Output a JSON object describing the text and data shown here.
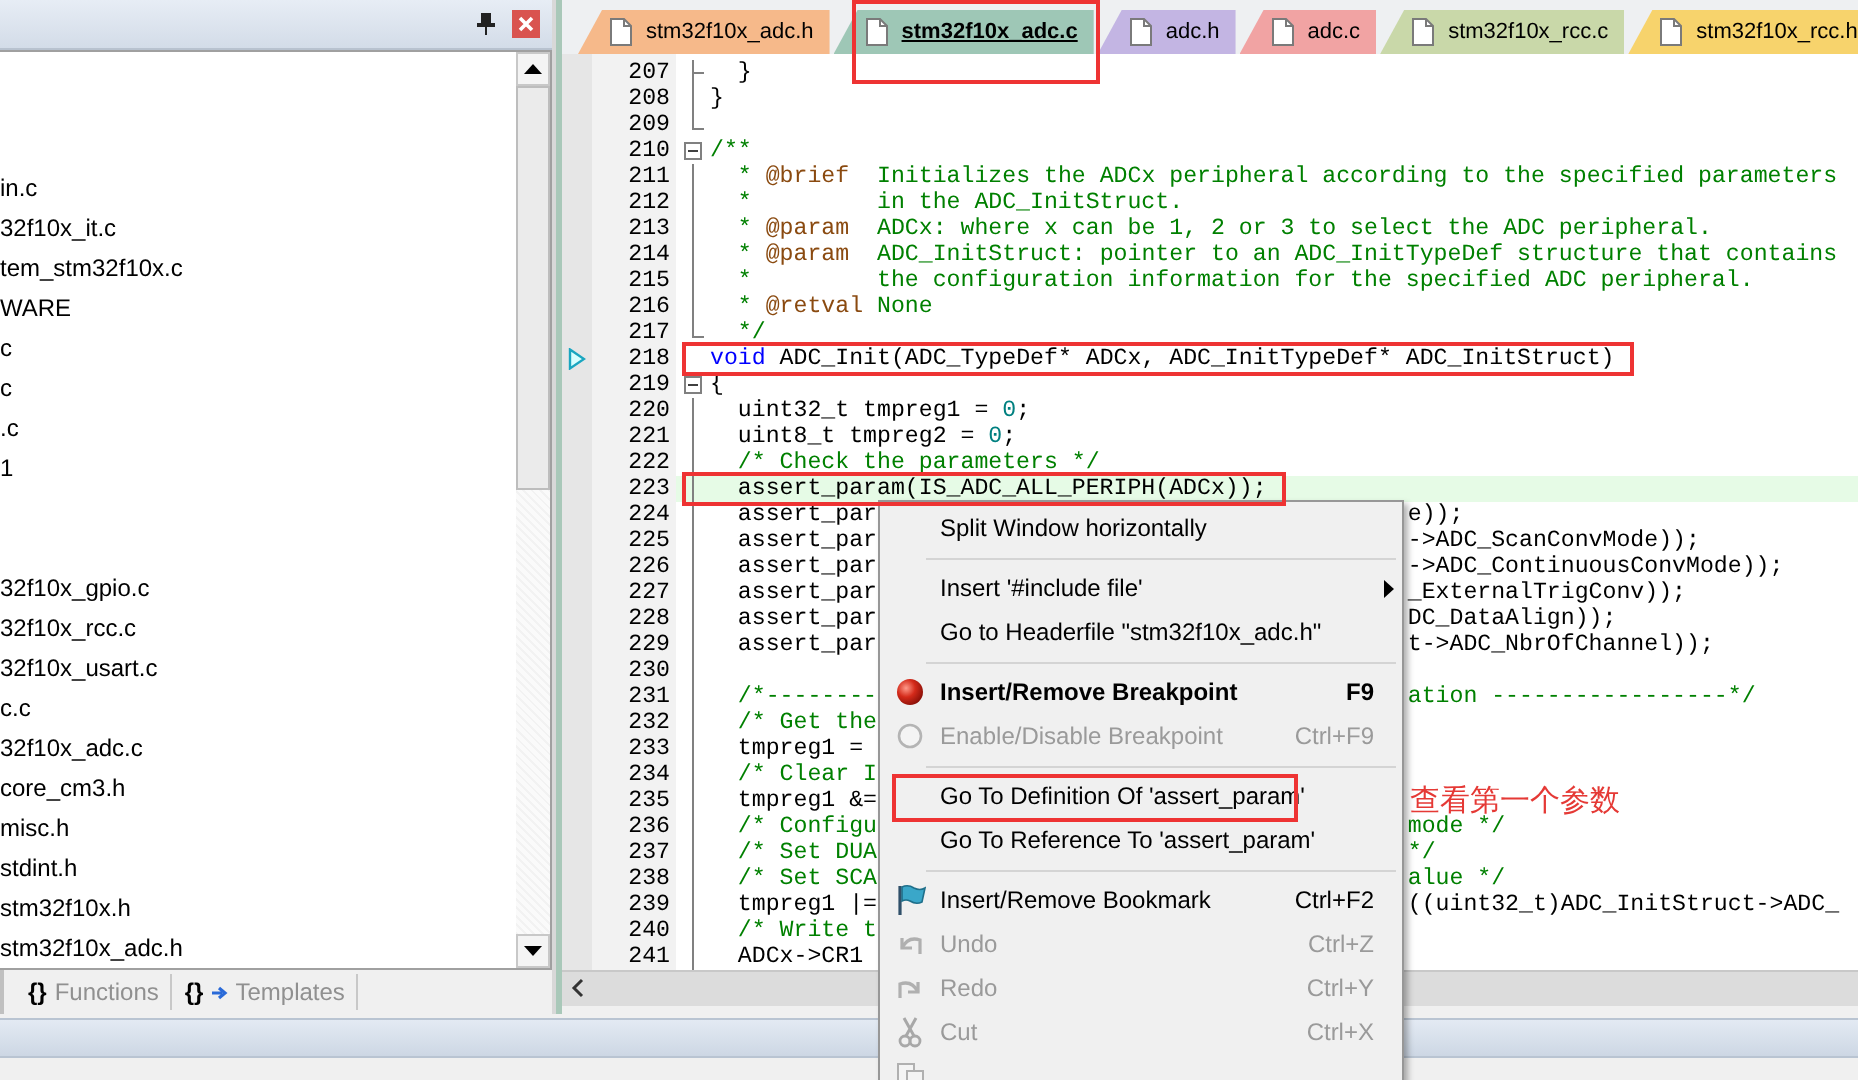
{
  "left_panel": {
    "tree": {
      "groups": [
        {
          "items": [
            {
              "label": "in.c"
            },
            {
              "label": "32f10x_it.c"
            },
            {
              "label": "tem_stm32f10x.c"
            },
            {
              "label": "WARE"
            },
            {
              "label": "c"
            },
            {
              "label": "c"
            },
            {
              "label": ".c"
            },
            {
              "label": "1"
            }
          ]
        },
        {
          "items": [
            {
              "label": "32f10x_gpio.c"
            },
            {
              "label": "32f10x_rcc.c"
            },
            {
              "label": "32f10x_usart.c"
            },
            {
              "label": "c.c"
            },
            {
              "label": "32f10x_adc.c"
            },
            {
              "label": "core_cm3.h"
            },
            {
              "label": "misc.h"
            },
            {
              "label": "stdint.h"
            },
            {
              "label": "stm32f10x.h"
            },
            {
              "label": "stm32f10x_adc.h"
            }
          ]
        }
      ]
    },
    "bottom_tabs": [
      {
        "kind": "functions",
        "icon_text": "{}",
        "label": "Functions",
        "selected": false
      },
      {
        "kind": "templates",
        "icon_text": "{}",
        "label": "Templates",
        "selected": false
      }
    ]
  },
  "editor": {
    "tabs": [
      {
        "label": "stm32f10x_adc.h",
        "color": "#f6b98a",
        "selected": false,
        "framed": false
      },
      {
        "label": "stm32f10x_adc.c",
        "color": "#9ec7b6",
        "selected": true,
        "framed": true
      },
      {
        "label": "adc.h",
        "color": "#c3b5e3",
        "selected": false,
        "framed": false
      },
      {
        "label": "adc.c",
        "color": "#f1a3a3",
        "selected": false,
        "framed": false
      },
      {
        "label": "stm32f10x_rcc.c",
        "color": "#c9d8a9",
        "selected": false,
        "framed": false
      },
      {
        "label": "stm32f10x_rcc.h",
        "color": "#f7d36c",
        "selected": false,
        "framed": false
      }
    ],
    "lines": [
      {
        "num": "207",
        "kind": "fold-tick",
        "pointer": false,
        "highlighted": false,
        "framed": false,
        "code": [
          {
            "kind": "plain",
            "text": "  }"
          }
        ]
      },
      {
        "num": "208",
        "kind": "fold-line",
        "pointer": false,
        "highlighted": false,
        "framed": false,
        "code": [
          {
            "kind": "plain",
            "text": "}"
          }
        ]
      },
      {
        "num": "209",
        "kind": "fold-end",
        "pointer": false,
        "highlighted": false,
        "framed": false
      },
      {
        "num": "210",
        "kind": "fold-start",
        "pointer": false,
        "highlighted": false,
        "framed": false,
        "code": [
          {
            "kind": "comment",
            "text": "/**"
          }
        ]
      },
      {
        "num": "211",
        "kind": "fold-line",
        "pointer": false,
        "highlighted": false,
        "framed": false,
        "code": [
          {
            "kind": "comment",
            "text": "  * "
          },
          {
            "kind": "tag",
            "text": "@brief"
          },
          {
            "kind": "comment",
            "text": "  Initializes the ADCx peripheral according to the specified parameters"
          }
        ]
      },
      {
        "num": "212",
        "kind": "fold-line",
        "pointer": false,
        "highlighted": false,
        "framed": false,
        "code": [
          {
            "kind": "comment",
            "text": "  *         in the ADC_InitStruct."
          }
        ]
      },
      {
        "num": "213",
        "kind": "fold-line",
        "pointer": false,
        "highlighted": false,
        "framed": false,
        "code": [
          {
            "kind": "comment",
            "text": "  * "
          },
          {
            "kind": "tag",
            "text": "@param"
          },
          {
            "kind": "comment",
            "text": "  ADCx: where x can be 1, 2 or 3 to select the ADC peripheral."
          }
        ]
      },
      {
        "num": "214",
        "kind": "fold-line",
        "pointer": false,
        "highlighted": false,
        "framed": false,
        "code": [
          {
            "kind": "comment",
            "text": "  * "
          },
          {
            "kind": "tag",
            "text": "@param"
          },
          {
            "kind": "comment",
            "text": "  ADC_InitStruct: pointer to an ADC_InitTypeDef structure that contains"
          }
        ]
      },
      {
        "num": "215",
        "kind": "fold-line",
        "pointer": false,
        "highlighted": false,
        "framed": false,
        "code": [
          {
            "kind": "comment",
            "text": "  *         the configuration information for the specified ADC peripheral."
          }
        ]
      },
      {
        "num": "216",
        "kind": "fold-line",
        "pointer": false,
        "highlighted": false,
        "framed": false,
        "code": [
          {
            "kind": "comment",
            "text": "  * "
          },
          {
            "kind": "tag",
            "text": "@retval"
          },
          {
            "kind": "comment",
            "text": " None"
          }
        ]
      },
      {
        "num": "217",
        "kind": "fold-end",
        "pointer": false,
        "highlighted": false,
        "framed": false,
        "code": [
          {
            "kind": "comment",
            "text": "  */"
          }
        ]
      },
      {
        "num": "218",
        "kind": "plain",
        "pointer": true,
        "highlighted": false,
        "framed": true,
        "code": [
          {
            "kind": "keyword",
            "text": "void"
          },
          {
            "kind": "plain",
            "text": " ADC_Init(ADC_TypeDef* ADCx, ADC_InitTypeDef* ADC_InitStruct)"
          }
        ]
      },
      {
        "num": "219",
        "kind": "fold-start",
        "pointer": false,
        "highlighted": false,
        "framed": false,
        "code": [
          {
            "kind": "plain",
            "text": "{"
          }
        ]
      },
      {
        "num": "220",
        "kind": "fold-line",
        "pointer": false,
        "highlighted": false,
        "framed": false,
        "code": [
          {
            "kind": "plain",
            "text": "  uint32_t tmpreg1 = "
          },
          {
            "kind": "number",
            "text": "0"
          },
          {
            "kind": "plain",
            "text": ";"
          }
        ]
      },
      {
        "num": "221",
        "kind": "fold-line",
        "pointer": false,
        "highlighted": false,
        "framed": false,
        "code": [
          {
            "kind": "plain",
            "text": "  uint8_t tmpreg2 = "
          },
          {
            "kind": "number",
            "text": "0"
          },
          {
            "kind": "plain",
            "text": ";"
          }
        ]
      },
      {
        "num": "222",
        "kind": "fold-line",
        "pointer": false,
        "highlighted": false,
        "framed": false,
        "code": [
          {
            "kind": "comment",
            "text": "  /* Check the parameters */"
          }
        ]
      },
      {
        "num": "223",
        "kind": "fold-line",
        "pointer": false,
        "highlighted": true,
        "framed": true,
        "code": [
          {
            "kind": "plain",
            "text": "  assert_param(IS_ADC_ALL_PERIPH(ADCx));"
          }
        ]
      },
      {
        "num": "224",
        "kind": "fold-line",
        "pointer": false,
        "highlighted": false,
        "framed": false,
        "code": [
          {
            "kind": "plain",
            "text": "  assert_par"
          }
        ],
        "code_after_menu": [
          {
            "kind": "plain",
            "text": "e));"
          }
        ]
      },
      {
        "num": "225",
        "kind": "fold-line",
        "pointer": false,
        "highlighted": false,
        "framed": false,
        "code": [
          {
            "kind": "plain",
            "text": "  assert_par"
          }
        ],
        "code_after_menu": [
          {
            "kind": "plain",
            "text": "->ADC_ScanConvMode));"
          }
        ]
      },
      {
        "num": "226",
        "kind": "fold-line",
        "pointer": false,
        "highlighted": false,
        "framed": false,
        "code": [
          {
            "kind": "plain",
            "text": "  assert_par"
          }
        ],
        "code_after_menu": [
          {
            "kind": "plain",
            "text": "->ADC_ContinuousConvMode));"
          }
        ]
      },
      {
        "num": "227",
        "kind": "fold-line",
        "pointer": false,
        "highlighted": false,
        "framed": false,
        "code": [
          {
            "kind": "plain",
            "text": "  assert_par"
          }
        ],
        "code_after_menu": [
          {
            "kind": "plain",
            "text": "_ExternalTrigConv));"
          }
        ]
      },
      {
        "num": "228",
        "kind": "fold-line",
        "pointer": false,
        "highlighted": false,
        "framed": false,
        "code": [
          {
            "kind": "plain",
            "text": "  assert_par"
          }
        ],
        "code_after_menu": [
          {
            "kind": "plain",
            "text": "DC_DataAlign));"
          }
        ]
      },
      {
        "num": "229",
        "kind": "fold-line",
        "pointer": false,
        "highlighted": false,
        "framed": false,
        "code": [
          {
            "kind": "plain",
            "text": "  assert_par"
          }
        ],
        "code_after_menu": [
          {
            "kind": "plain",
            "text": "t->ADC_NbrOfChannel));"
          }
        ]
      },
      {
        "num": "230",
        "kind": "fold-line",
        "pointer": false,
        "highlighted": false,
        "framed": false
      },
      {
        "num": "231",
        "kind": "fold-line",
        "pointer": false,
        "highlighted": false,
        "framed": false,
        "code": [
          {
            "kind": "comment",
            "text": "  /*--------"
          }
        ],
        "code_after_menu": [
          {
            "kind": "comment",
            "text": "ation -----------------*/"
          }
        ]
      },
      {
        "num": "232",
        "kind": "fold-line",
        "pointer": false,
        "highlighted": false,
        "framed": false,
        "code": [
          {
            "kind": "comment",
            "text": "  /* Get the"
          }
        ]
      },
      {
        "num": "233",
        "kind": "fold-line",
        "pointer": false,
        "highlighted": false,
        "framed": false,
        "code": [
          {
            "kind": "plain",
            "text": "  tmpreg1 ="
          }
        ]
      },
      {
        "num": "234",
        "kind": "fold-line",
        "pointer": false,
        "highlighted": false,
        "framed": false,
        "code": [
          {
            "kind": "comment",
            "text": "  /* Clear I"
          }
        ]
      },
      {
        "num": "235",
        "kind": "fold-line",
        "pointer": false,
        "highlighted": false,
        "framed": false,
        "code": [
          {
            "kind": "plain",
            "text": "  tmpreg1 &="
          }
        ]
      },
      {
        "num": "236",
        "kind": "fold-line",
        "pointer": false,
        "highlighted": false,
        "framed": false,
        "code": [
          {
            "kind": "comment",
            "text": "  /* Configu"
          }
        ],
        "code_after_menu": [
          {
            "kind": "comment",
            "text": "mode */"
          }
        ]
      },
      {
        "num": "237",
        "kind": "fold-line",
        "pointer": false,
        "highlighted": false,
        "framed": false,
        "code": [
          {
            "kind": "comment",
            "text": "  /* Set DUA"
          }
        ],
        "code_after_menu": [
          {
            "kind": "comment",
            "text": "*/"
          }
        ]
      },
      {
        "num": "238",
        "kind": "fold-line",
        "pointer": false,
        "highlighted": false,
        "framed": false,
        "code": [
          {
            "kind": "comment",
            "text": "  /* Set SCA"
          }
        ],
        "code_after_menu": [
          {
            "kind": "comment",
            "text": "alue */"
          }
        ]
      },
      {
        "num": "239",
        "kind": "fold-line",
        "pointer": false,
        "highlighted": false,
        "framed": false,
        "code": [
          {
            "kind": "plain",
            "text": "  tmpreg1 |="
          }
        ],
        "code_after_menu": [
          {
            "kind": "plain",
            "text": "((uint32_t)ADC_InitStruct->ADC_"
          }
        ]
      },
      {
        "num": "240",
        "kind": "fold-line",
        "pointer": false,
        "highlighted": false,
        "framed": false,
        "code": [
          {
            "kind": "comment",
            "text": "  /* Write t"
          }
        ]
      },
      {
        "num": "241",
        "kind": "fold-line",
        "pointer": false,
        "highlighted": false,
        "framed": false,
        "code": [
          {
            "kind": "plain",
            "text": "  ADCx->CR1"
          }
        ]
      }
    ]
  },
  "context_menu": {
    "items": [
      {
        "kind": "item",
        "label": "Split Window horizontally",
        "bold": false,
        "disabled": false,
        "submenu": false,
        "framed": false
      },
      {
        "kind": "separator"
      },
      {
        "kind": "item",
        "label": "Insert '#include file'",
        "bold": false,
        "disabled": false,
        "submenu": true,
        "framed": false
      },
      {
        "kind": "item",
        "label": "Go to Headerfile \"stm32f10x_adc.h\"",
        "bold": false,
        "disabled": false,
        "submenu": false,
        "framed": false
      },
      {
        "kind": "separator"
      },
      {
        "kind": "breakpoint",
        "label": "Insert/Remove Breakpoint",
        "shortcut": "F9",
        "bold": true,
        "disabled": false,
        "submenu": false,
        "framed": false
      },
      {
        "kind": "breakpoint-toggle",
        "label": "Enable/Disable Breakpoint",
        "shortcut": "Ctrl+F9",
        "bold": false,
        "disabled": true,
        "submenu": false,
        "framed": false
      },
      {
        "kind": "separator"
      },
      {
        "kind": "item",
        "label": "Go To Definition Of 'assert_param'",
        "bold": false,
        "disabled": false,
        "submenu": false,
        "framed": true
      },
      {
        "kind": "item",
        "label": "Go To Reference To 'assert_param'",
        "bold": false,
        "disabled": false,
        "submenu": false,
        "framed": false
      },
      {
        "kind": "separator"
      },
      {
        "kind": "bookmark",
        "label": "Insert/Remove Bookmark",
        "shortcut": "Ctrl+F2",
        "bold": false,
        "disabled": false,
        "submenu": false,
        "framed": false
      },
      {
        "kind": "undo",
        "label": "Undo",
        "shortcut": "Ctrl+Z",
        "bold": false,
        "disabled": true,
        "submenu": false,
        "framed": false
      },
      {
        "kind": "redo",
        "label": "Redo",
        "shortcut": "Ctrl+Y",
        "bold": false,
        "disabled": true,
        "submenu": false,
        "framed": false
      },
      {
        "kind": "cut",
        "label": "Cut",
        "shortcut": "Ctrl+X",
        "bold": false,
        "disabled": true,
        "submenu": false,
        "framed": false
      },
      {
        "kind": "copy"
      }
    ]
  },
  "annotation": {
    "text": "查看第一个参数"
  }
}
